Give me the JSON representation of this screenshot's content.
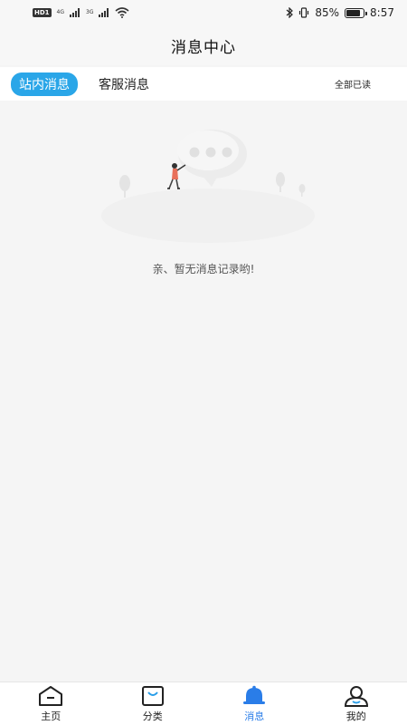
{
  "status_bar": {
    "hd": "HD",
    "sim": "1",
    "net1": "4G",
    "net2": "3G",
    "battery_percent": "85%",
    "battery_level": 0.85,
    "time": "8:57"
  },
  "header": {
    "title": "消息中心"
  },
  "tabs": [
    {
      "label": "站内消息",
      "active": true
    },
    {
      "label": "客服消息",
      "active": false
    }
  ],
  "mark_all_read": "全部已读",
  "empty_state": {
    "text": "亲、暂无消息记录哟!"
  },
  "bottom_nav": [
    {
      "label": "主页",
      "icon": "home-icon",
      "active": false
    },
    {
      "label": "分类",
      "icon": "bag-icon",
      "active": false
    },
    {
      "label": "消息",
      "icon": "bell-icon",
      "active": true
    },
    {
      "label": "我的",
      "icon": "user-icon",
      "active": false
    }
  ],
  "colors": {
    "accent": "#2aa6e8",
    "nav_active": "#2a7de8",
    "background": "#f5f5f5"
  }
}
